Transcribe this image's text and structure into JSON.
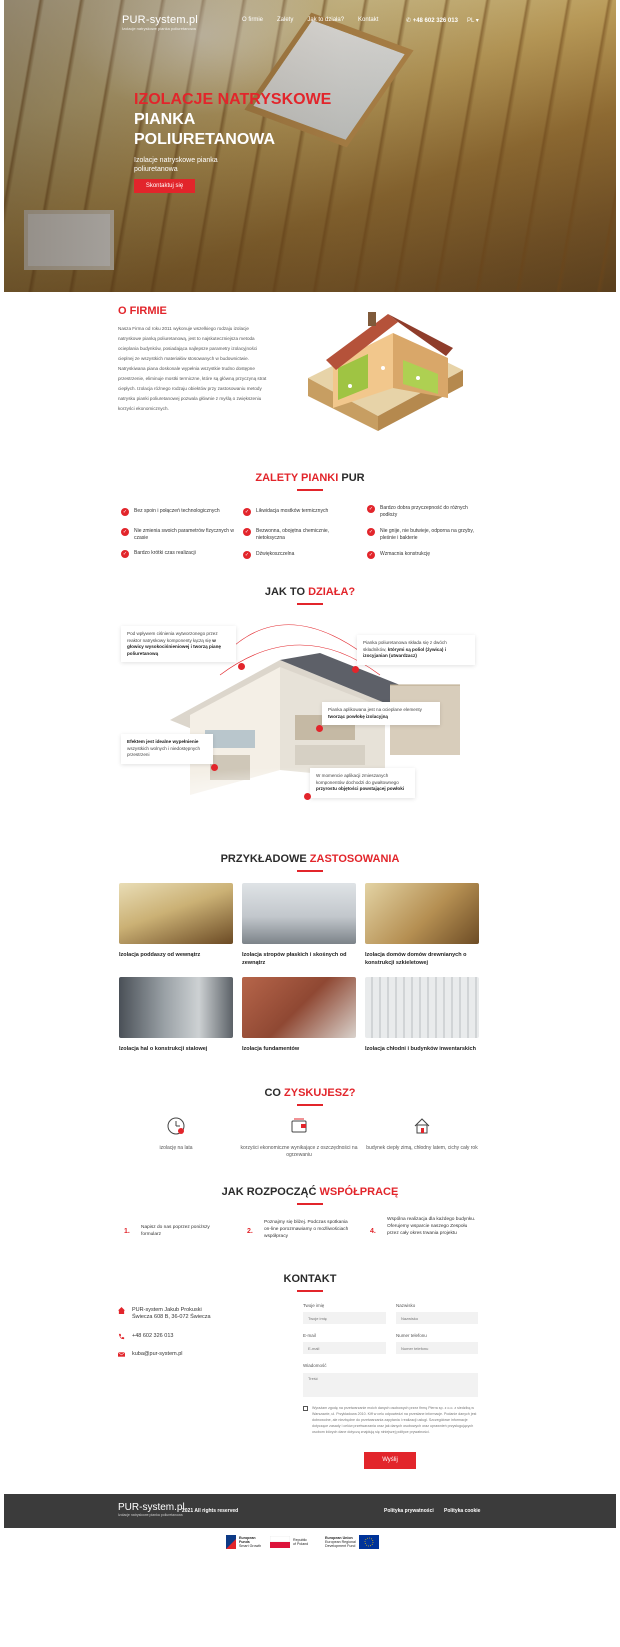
{
  "nav": {
    "brand": "PUR-system.pl",
    "tagline": "Izolacje natryskowe pianka poliuretanowa",
    "menu": [
      "O firmie",
      "Zalety",
      "Jak to działa?",
      "Kontakt"
    ],
    "phone": "+48 602 326 013",
    "lang": "PL"
  },
  "hero": {
    "title_red": "Izolacje natryskowe",
    "title_white": "pianka poliuretanowa",
    "subtitle": "Izolacje natryskowe pianka poliuretanowa",
    "cta": "Skontaktuj się"
  },
  "about": {
    "title": "O firmie",
    "text": "Nasza Firma od roku 2011 wykonuje wszelkiego rodzaju izolacje natryskowe pianką poliuretanową, jest to najskuteczniejsza metoda ocieplania budynków, posiadająca najlepsze parametry izolacyjności cieplnej ze wszystkich materiałów stosowanych w budownictwie. Natryskiwana piana doskonale wypełnia wszystkie trudno dostępne przestrzenie, eliminuje mostki termiczne, które są główną przyczyną strat ciepłych. Izolacja różnego rodzaju obiektów przy zastosowaniu metody natrysku pianki poliuretanowej pozwala głównie z myślą o zwiększeniu korzyści ekonomicznych."
  },
  "advantages": {
    "title_dark_1": "Zalety",
    "title_red": "pianki",
    "title_dark_2": "PUR",
    "items": [
      "Bez spoin i połączeń technologicznych",
      "Likwidacja mostków termicznych",
      "Bardzo dobra przyczepność do różnych podłoży",
      "Nie zmienia swoich parametrów fizycznych w czasie",
      "Bezwonna, obojętna chemicznie, nietoksyczna",
      "Nie gnije, nie butwieje, odporna na grzyby, pleśnie i bakterie",
      "Bardzo krótki czas realizacji",
      "Dźwiękoszczelna",
      "Wzmacnia konstrukcję"
    ]
  },
  "how": {
    "title_dark": "Jak to",
    "title_red": "działa?",
    "b1_pre": "Pod wpływem ciśnienia wytworzonego przez reaktor natryskowy komponenty łączą się ",
    "b1_bold": "w głowicy wysokociśnieniowej i tworzą pianę poliuretanową",
    "b2_pre": "Pianka poliuretanowa składa się z dwóch składników, ",
    "b2_bold": "którymi są poliol (żywica) i izocyjanian (utwardzacz)",
    "b3_pre": "Pianka aplikowana jest na ocieplane elementy ",
    "b3_bold": "tworząc powłokę izolacyjną",
    "b4_bold": "Efektem jest idealne wypełnienie",
    "b4_post": " wszystkich wolnych i niedostępnych przestrzeni",
    "b5_pre": "W momencie aplikacji zmieszanych komponentów dochodzi do gwałtownego ",
    "b5_bold": "przyrostu objętości powstającej powłoki"
  },
  "applications": {
    "title_dark": "Przykładowe",
    "title_red": "zastosowania",
    "items": [
      "Izolacja poddaszy od wewnątrz",
      "Izolacja stropów płaskich i skośnych od zewnątrz",
      "Izolacja domów domów drewnianych o konstrukcji szkieletowej",
      "Izolacja hal o konstrukcji stalowej",
      "Izolacja fundamentów",
      "Izolacja chłodni i budynków inwentarskich"
    ]
  },
  "gains": {
    "title_dark": "Co",
    "title_red": "zyskujesz?",
    "items": [
      {
        "icon": "clock-icon",
        "text": "izolację na lata"
      },
      {
        "icon": "wallet-icon",
        "text": "korzyści ekonomiczne wynikające z oszczędności na ogrzewaniu"
      },
      {
        "icon": "house-icon",
        "text": "budynek ciepły zimą, chłodny latem, cichy cały rok"
      }
    ]
  },
  "steps": {
    "title_dark": "Jak rozpocząć",
    "title_red": "współpracę",
    "items": [
      {
        "num": "1.",
        "text": "Napisz do nas poprzez poniższy formularz"
      },
      {
        "num": "2.",
        "text": "Poznajmy się bliżej. Podczas spotkania on-line porozmawiamy o możliwościach współpracy"
      },
      {
        "num": "4.",
        "text": "Wspólna realizacja dla każdego budynku. Oferujemy wsparcie naszego Zespołu przez cały okres trwania projektu"
      }
    ]
  },
  "contact": {
    "title": "Kontakt",
    "address_1": "PUR-system Jakub Prokuski",
    "address_2": "Świecza 608 B, 36-072 Świecza",
    "phone": "+48 602 326 013",
    "email": "kuba@pur-system.pl",
    "form": {
      "name_label": "Twoje imię",
      "name_ph": "Twoje imię",
      "surname_label": "Nazwisko",
      "surname_ph": "Nazwisko",
      "email_label": "E-mail",
      "email_ph": "E-mail",
      "phone_label": "Numer telefonu",
      "phone_ph": "Numer telefonu",
      "message_label": "Wiadomość",
      "message_ph": "Treść",
      "consent": "Wyrażam zgodę na przetwarzanie moich danych osobowych przez firmę Pierra sp. z o.o. z siedzibą w Warszawie, ul. Przykładowa 2010. Kiff w celu odpowiedzi na przesłane informacje. Podanie danych jest dobrowolne, ale niezbędne do przetwarzania zapytania i realizacji usługi. Szczegółowe informacje dotyczące zasady i celów przetwarzania oraz jak danych osobowych oraz uprawnień przysługujących osobom których dane dotyczą znajdują się niniejszej polityce prywatności.",
      "submit": "Wyślij"
    }
  },
  "footer": {
    "brand": "PUR-system.pl",
    "tagline": "Izolacje natryskowe pianka poliuretanowa",
    "copyright": "2021 All rights reserved",
    "privacy": "Polityka prywatności",
    "cookies": "Polityka cookie"
  },
  "eu": {
    "funds_1": "European",
    "funds_2": "Funds",
    "funds_3": "Smart Growth",
    "poland_1": "Republic",
    "poland_2": "of Poland",
    "union_1": "European Union",
    "union_2": "European Regional",
    "union_3": "Development Fund"
  },
  "colors": {
    "accent": "#e2252b",
    "footer": "#3b3b3b"
  }
}
